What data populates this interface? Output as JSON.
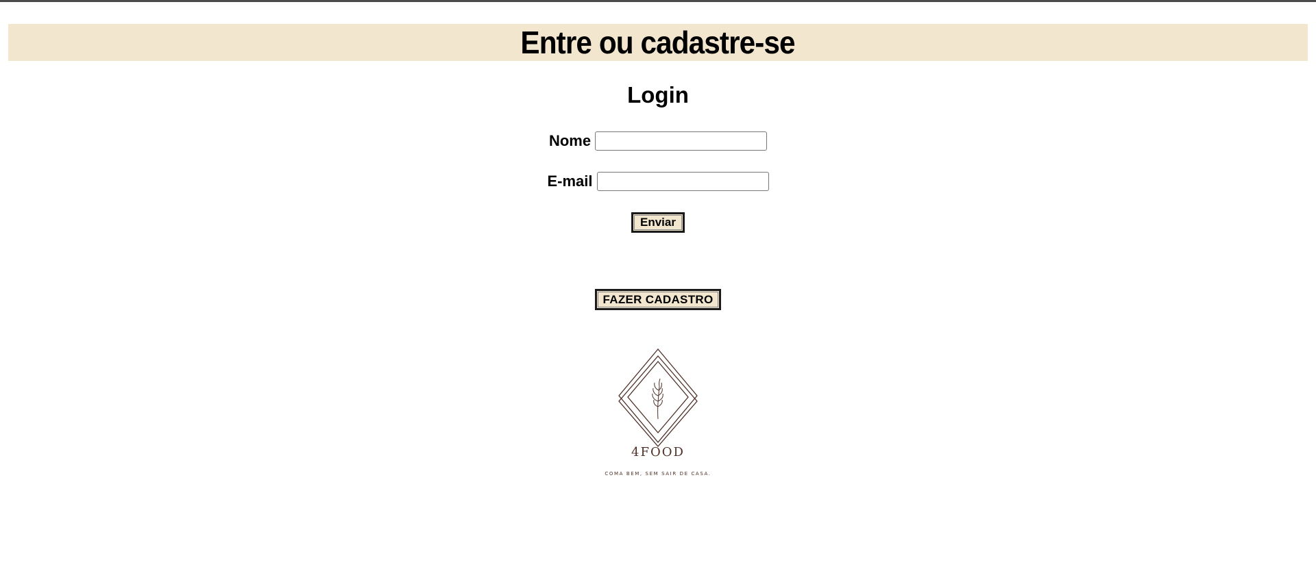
{
  "header": {
    "title": "Entre ou cadastre-se"
  },
  "login": {
    "title": "Login",
    "nome_label": "Nome",
    "nome_value": "",
    "email_label": "E-mail",
    "email_value": "",
    "submit_label": "Enviar"
  },
  "signup": {
    "button_label": "FAZER CADASTRO"
  },
  "logo": {
    "icon": "wheat-sprig-diamond-logo",
    "name": "4FOOD",
    "tagline": "COMA BEM, SEM SAIR DE CASA.",
    "color": "#4e2f26"
  },
  "colors": {
    "accent": "#f3e6cf",
    "text": "#000000"
  }
}
